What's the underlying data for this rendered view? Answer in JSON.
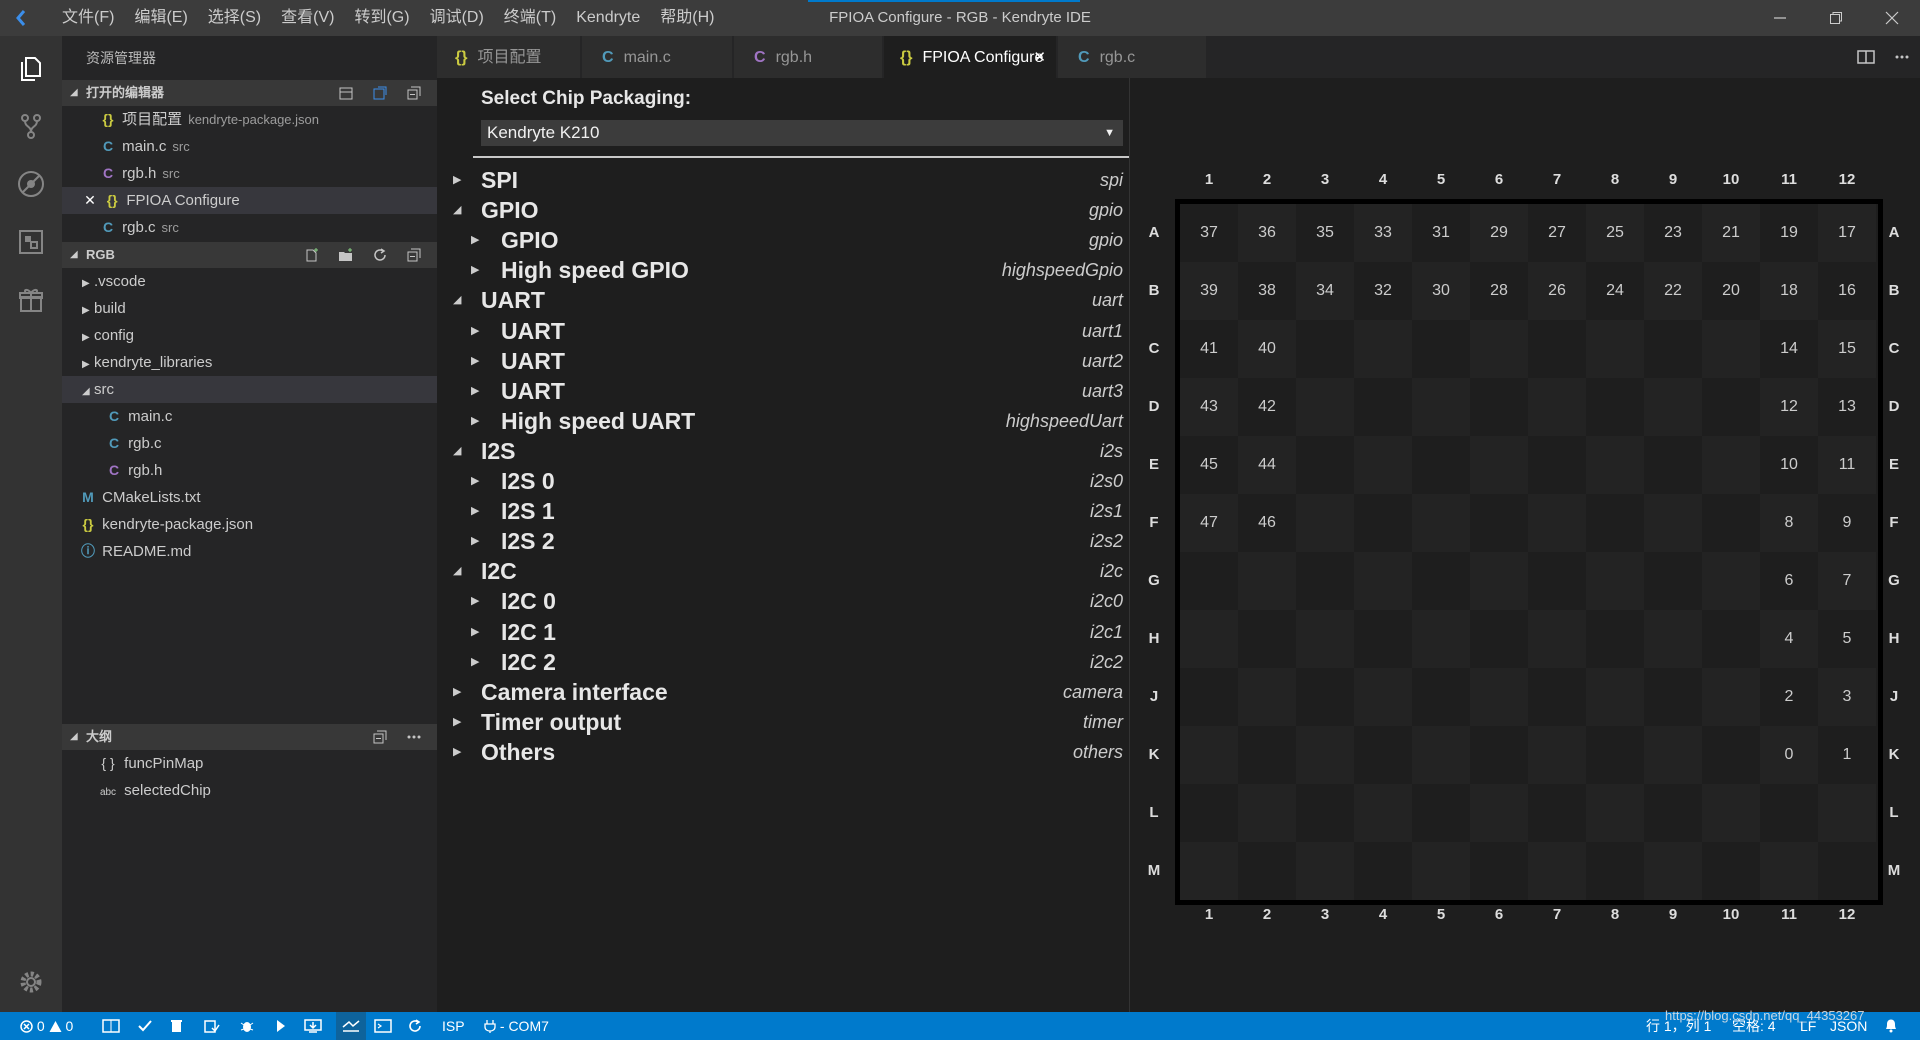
{
  "window": {
    "title": "FPIOA Configure - RGB - Kendryte IDE",
    "menus": [
      "文件(F)",
      "编辑(E)",
      "选择(S)",
      "查看(V)",
      "转到(G)",
      "调试(D)",
      "终端(T)",
      "Kendryte",
      "帮助(H)"
    ]
  },
  "sidebar": {
    "title": "资源管理器",
    "open_editors": {
      "header": "打开的编辑器",
      "items": [
        {
          "icon": "{}",
          "name": "项目配置",
          "desc": "kendryte-package.json"
        },
        {
          "icon": "C",
          "name": "main.c",
          "desc": "src"
        },
        {
          "icon": "C",
          "name": "rgb.h",
          "desc": "src"
        },
        {
          "icon": "{}",
          "name": "FPIOA Configure",
          "desc": ""
        },
        {
          "icon": "C",
          "name": "rgb.c",
          "desc": "src"
        }
      ]
    },
    "project": {
      "header": "RGB",
      "items": [
        {
          "icon": "",
          "name": ".vscode"
        },
        {
          "icon": "",
          "name": "build"
        },
        {
          "icon": "",
          "name": "config"
        },
        {
          "icon": "",
          "name": "kendryte_libraries"
        },
        {
          "icon": "",
          "name": "src"
        },
        {
          "icon": "C",
          "name": "main.c"
        },
        {
          "icon": "C",
          "name": "rgb.c"
        },
        {
          "icon": "C",
          "name": "rgb.h"
        },
        {
          "icon": "M",
          "name": "CMakeLists.txt"
        },
        {
          "icon": "{}",
          "name": "kendryte-package.json"
        },
        {
          "icon": "ⓘ",
          "name": "README.md"
        }
      ]
    },
    "outline": {
      "header": "大纲",
      "items": [
        {
          "icon": "{ }",
          "name": "funcPinMap"
        },
        {
          "icon": "abc",
          "name": "selectedChip"
        }
      ]
    }
  },
  "tabs": [
    {
      "icon": "{}",
      "label": "项目配置"
    },
    {
      "icon": "C",
      "label": "main.c"
    },
    {
      "icon": "C",
      "label": "rgb.h"
    },
    {
      "icon": "{}",
      "label": "FPIOA Configure"
    },
    {
      "icon": "C",
      "label": "rgb.c"
    }
  ],
  "config": {
    "chip_label": "Select Chip Packaging:",
    "chip_value": "Kendryte K210",
    "tree": [
      {
        "label": "SPI",
        "id": "spi",
        "level": 0,
        "expanded": false
      },
      {
        "label": "GPIO",
        "id": "gpio",
        "level": 0,
        "expanded": true
      },
      {
        "label": "GPIO",
        "id": "gpio",
        "level": 1,
        "expanded": false
      },
      {
        "label": "High speed GPIO",
        "id": "highspeedGpio",
        "level": 1,
        "expanded": false
      },
      {
        "label": "UART",
        "id": "uart",
        "level": 0,
        "expanded": true
      },
      {
        "label": "UART",
        "id": "uart1",
        "level": 1,
        "expanded": false
      },
      {
        "label": "UART",
        "id": "uart2",
        "level": 1,
        "expanded": false
      },
      {
        "label": "UART",
        "id": "uart3",
        "level": 1,
        "expanded": false
      },
      {
        "label": "High speed UART",
        "id": "highspeedUart",
        "level": 1,
        "expanded": false
      },
      {
        "label": "I2S",
        "id": "i2s",
        "level": 0,
        "expanded": true
      },
      {
        "label": "I2S 0",
        "id": "i2s0",
        "level": 1,
        "expanded": false
      },
      {
        "label": "I2S 1",
        "id": "i2s1",
        "level": 1,
        "expanded": false
      },
      {
        "label": "I2S 2",
        "id": "i2s2",
        "level": 1,
        "expanded": false
      },
      {
        "label": "I2C",
        "id": "i2c",
        "level": 0,
        "expanded": true
      },
      {
        "label": "I2C 0",
        "id": "i2c0",
        "level": 1,
        "expanded": false
      },
      {
        "label": "I2C 1",
        "id": "i2c1",
        "level": 1,
        "expanded": false
      },
      {
        "label": "I2C 2",
        "id": "i2c2",
        "level": 1,
        "expanded": false
      },
      {
        "label": "Camera interface",
        "id": "camera",
        "level": 0,
        "expanded": false
      },
      {
        "label": "Timer output",
        "id": "timer",
        "level": 0,
        "expanded": false
      },
      {
        "label": "Others",
        "id": "others",
        "level": 0,
        "expanded": false
      }
    ]
  },
  "pin_grid": {
    "columns": [
      "1",
      "2",
      "3",
      "4",
      "5",
      "6",
      "7",
      "8",
      "9",
      "10",
      "11",
      "12"
    ],
    "rows": [
      "A",
      "B",
      "C",
      "D",
      "E",
      "F",
      "G",
      "H",
      "J",
      "K",
      "L",
      "M"
    ],
    "cells": [
      [
        "37",
        "36",
        "35",
        "33",
        "31",
        "29",
        "27",
        "25",
        "23",
        "21",
        "19",
        "17"
      ],
      [
        "39",
        "38",
        "34",
        "32",
        "30",
        "28",
        "26",
        "24",
        "22",
        "20",
        "18",
        "16"
      ],
      [
        "41",
        "40",
        "",
        "",
        "",
        "",
        "",
        "",
        "",
        "",
        "14",
        "15"
      ],
      [
        "43",
        "42",
        "",
        "",
        "",
        "",
        "",
        "",
        "",
        "",
        "12",
        "13"
      ],
      [
        "45",
        "44",
        "",
        "",
        "",
        "",
        "",
        "",
        "",
        "",
        "10",
        "11"
      ],
      [
        "47",
        "46",
        "",
        "",
        "",
        "",
        "",
        "",
        "",
        "",
        "8",
        "9"
      ],
      [
        "",
        "",
        "",
        "",
        "",
        "",
        "",
        "",
        "",
        "",
        "6",
        "7"
      ],
      [
        "",
        "",
        "",
        "",
        "",
        "",
        "",
        "",
        "",
        "",
        "4",
        "5"
      ],
      [
        "",
        "",
        "",
        "",
        "",
        "",
        "",
        "",
        "",
        "",
        "2",
        "3"
      ],
      [
        "",
        "",
        "",
        "",
        "",
        "",
        "",
        "",
        "",
        "",
        "0",
        "1"
      ],
      [
        "",
        "",
        "",
        "",
        "",
        "",
        "",
        "",
        "",
        "",
        "",
        ""
      ],
      [
        "",
        "",
        "",
        "",
        "",
        "",
        "",
        "",
        "",
        "",
        "",
        ""
      ]
    ]
  },
  "statusbar": {
    "errors": "0",
    "warnings": "0",
    "isp": "ISP",
    "port": "- COM7",
    "position": "行 1，列 1",
    "spaces": "空格: 4",
    "eol": "LF",
    "language": "JSON",
    "watermark": "https://blog.csdn.net/qq_44353267"
  }
}
